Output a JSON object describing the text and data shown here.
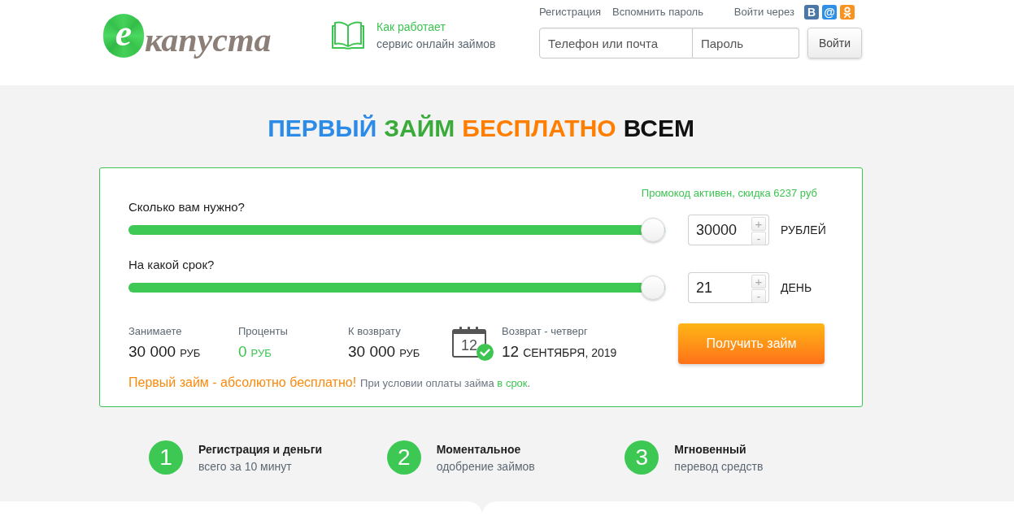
{
  "header": {
    "logo": {
      "mark": "е",
      "text": "капуста"
    },
    "how_it_works": {
      "title": "Как работает",
      "subtitle": "сервис онлайн займов"
    },
    "top_links": [
      "Регистрация",
      "Вспомнить пароль"
    ],
    "social_label": "Войти через",
    "social": [
      {
        "kind": "vk",
        "glyph": "В",
        "color": "#4a76a8"
      },
      {
        "kind": "mail",
        "glyph": "@",
        "color": "#2d8fe6"
      },
      {
        "kind": "ok",
        "color": "#f7931e"
      }
    ],
    "login": {
      "phone_placeholder": "Телефон или почта",
      "password_placeholder": "Пароль",
      "button": "Войти"
    }
  },
  "headline": [
    {
      "text": "ПЕРВЫЙ",
      "color": "#2b8be6"
    },
    {
      "text": "ЗАЙМ",
      "color": "#3aab3a"
    },
    {
      "text": "БЕСПЛАТНО",
      "color": "#ff7e00"
    },
    {
      "text": "ВСЕМ",
      "color": "#111111"
    }
  ],
  "calculator": {
    "promo": "Промокод активен, скидка 6237 руб",
    "sliders": [
      {
        "label": "Сколько вам нужно?",
        "level": 1,
        "value": "30000",
        "increment": "+",
        "decrement": "-",
        "unit": "РУБЛЕЙ"
      },
      {
        "label": "На какой срок?",
        "level": 1,
        "value": "21",
        "increment": "+",
        "decrement": "-",
        "unit": "ДЕНЬ"
      }
    ],
    "summary": [
      {
        "label": "Занимаете",
        "value": "30 000",
        "unit": "РУБ",
        "color": "#1f1f1f"
      },
      {
        "label": "Проценты",
        "value": "0",
        "unit": "РУБ",
        "color": "#3cc551"
      },
      {
        "label": "К возврату",
        "value": "30 000",
        "unit": "РУБ",
        "color": "#1f1f1f"
      }
    ],
    "return_date": {
      "calendar_day": "12",
      "label": "Возврат - четверг",
      "day": "12",
      "month_year": "СЕНТЯБРЯ, 2019"
    },
    "submit": "Получить займ",
    "disclaimer": {
      "highlight": "Первый займ - абсолютно бесплатно!",
      "note": "При условии оплаты займа",
      "link": "в срок",
      "end": "."
    }
  },
  "steps": [
    {
      "number": "1",
      "title": "Регистрация и деньги",
      "subtitle": "всего за 10 минут"
    },
    {
      "number": "2",
      "title": "Моментальное",
      "subtitle": "одобрение займов"
    },
    {
      "number": "3",
      "title": "Мгновенный",
      "subtitle": "перевод средств"
    }
  ]
}
